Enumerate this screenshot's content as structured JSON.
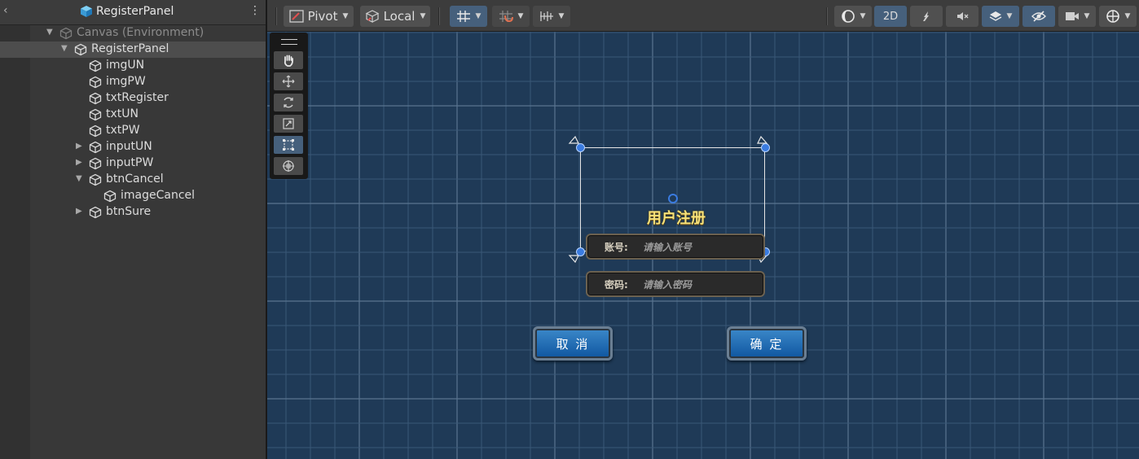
{
  "hierarchy": {
    "title": "RegisterPanel",
    "back_icon": "chevron-left-icon",
    "menu_icon": "kebab-menu-icon",
    "items": [
      {
        "label": "Canvas (Environment)",
        "depth": 0,
        "expanded": true,
        "dim": true,
        "selected": false
      },
      {
        "label": "RegisterPanel",
        "depth": 1,
        "expanded": true,
        "dim": false,
        "selected": true
      },
      {
        "label": "imgUN",
        "depth": 2,
        "expanded": null
      },
      {
        "label": "imgPW",
        "depth": 2,
        "expanded": null
      },
      {
        "label": "txtRegister",
        "depth": 2,
        "expanded": null
      },
      {
        "label": "txtUN",
        "depth": 2,
        "expanded": null
      },
      {
        "label": "txtPW",
        "depth": 2,
        "expanded": null
      },
      {
        "label": "inputUN",
        "depth": 2,
        "expanded": false
      },
      {
        "label": "inputPW",
        "depth": 2,
        "expanded": false
      },
      {
        "label": "btnCancel",
        "depth": 2,
        "expanded": true
      },
      {
        "label": "imageCancel",
        "depth": 3,
        "expanded": null
      },
      {
        "label": "btnSure",
        "depth": 2,
        "expanded": false
      }
    ]
  },
  "toolbar": {
    "pivot_label": "Pivot",
    "local_label": "Local",
    "mode_2d_label": "2D"
  },
  "scene": {
    "panel_title": "用户注册",
    "account_label": "账号:",
    "account_placeholder": "请输入账号",
    "password_label": "密码:",
    "password_placeholder": "请输入密码",
    "cancel_label": "取 消",
    "confirm_label": "确 定"
  },
  "colors": {
    "scene_bg": "#1f3a57",
    "grid": "#4a6480",
    "selection": "#3a7be0",
    "title_gold": "#f7e27a",
    "button_blue": "#1565b0"
  }
}
